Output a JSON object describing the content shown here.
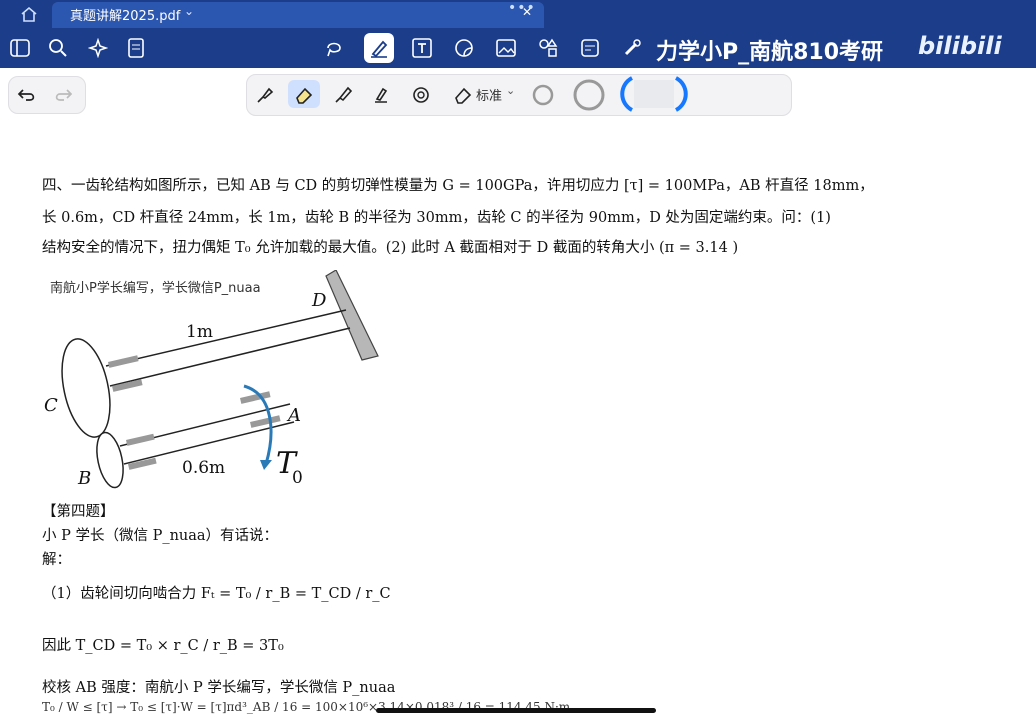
{
  "tab": {
    "title": "真题讲解2025.pdf",
    "chevron": "⌄",
    "dots": "•••",
    "close": "✕"
  },
  "toolbar": {
    "icons": [
      "sidebar-icon",
      "search-icon",
      "sparkle-icon",
      "document-icon",
      "lasso-icon",
      "pen-icon",
      "text-box-icon",
      "sticker-icon",
      "image-icon",
      "shapes-icon",
      "note-icon",
      "laser-pointer-icon"
    ],
    "right_icons": [
      "export-icon",
      "share-icon",
      "more-icon"
    ]
  },
  "watermark": {
    "channel": "力学小P_南航810考研",
    "logo": "bilibili"
  },
  "pen_tools": {
    "undo": "undo-icon",
    "redo": "redo-icon",
    "preset_label": "标准",
    "tools": [
      "fountain-pen-icon",
      "eraser-icon",
      "highlighter-icon",
      "marker-icon",
      "lasso-select-icon"
    ],
    "colors": {
      "accent": "#1677ff",
      "toolbar_bg": "#1b3d8a",
      "tab_bg": "#2c57b0"
    }
  },
  "problem": {
    "line1": "四、一齿轮结构如图所示，已知 AB 与 CD 的剪切弹性模量为 G = 100GPa，许用切应力 [τ] = 100MPa，AB 杆直径 18mm，",
    "line2": "长 0.6m，CD 杆直径 24mm，长 1m，齿轮 B 的半径为 30mm，齿轮 C 的半径为 90mm，D 处为固定端约束。问：(1)",
    "line3": "结构安全的情况下，扭力偶矩 T₀ 允许加载的最大值。(2) 此时 A 截面相对于 D 截面的转角大小 (π = 3.14 )"
  },
  "figure": {
    "caption": "南航小P学长编写，学长微信P_nuaa",
    "labels": {
      "D": "D",
      "C": "C",
      "B": "B",
      "A": "A",
      "len_cd": "1m",
      "len_ab": "0.6m",
      "torque": "T",
      "torque_sub": "0"
    }
  },
  "solution": {
    "heading": "【第四题】",
    "intro": "小 P 学长（微信 P_nuaa）有话说：",
    "jie": "解：",
    "step1": "（1）齿轮间切向啮合力 Fₜ = T₀ / r_B = T_CD / r_C",
    "step2": "因此 T_CD = T₀ × r_C / r_B = 3T₀",
    "step3": "校核 AB 强度：南航小 P 学长编写，学长微信 P_nuaa",
    "step4": "T₀ / W ≤ [τ] → T₀ ≤ [τ]·W = [τ]πd³_AB / 16 = 100×10⁶×3.14×0.018³ / 16 = 114.45 N·m"
  }
}
